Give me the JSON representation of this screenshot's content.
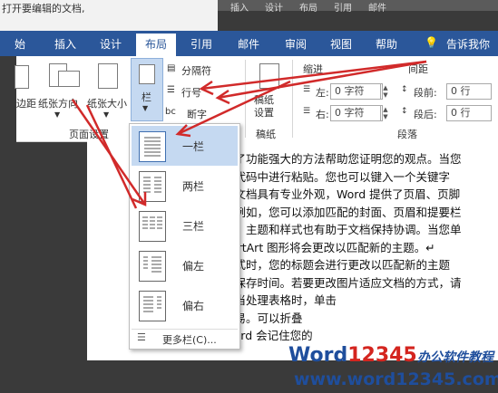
{
  "behind_window": {
    "text": "打开要编辑的文档,"
  },
  "behind_tabs": [
    "插入",
    "设计",
    "布局",
    "引用",
    "邮件"
  ],
  "tabs": [
    {
      "label": "始",
      "active": false
    },
    {
      "label": "插入",
      "active": false
    },
    {
      "label": "设计",
      "active": false
    },
    {
      "label": "布局",
      "active": true
    },
    {
      "label": "引用",
      "active": false
    },
    {
      "label": "邮件",
      "active": false
    },
    {
      "label": "审阅",
      "active": false
    },
    {
      "label": "视图",
      "active": false
    },
    {
      "label": "帮助",
      "active": false
    }
  ],
  "tell_me": "告诉我你",
  "ribbon": {
    "margins": "边距",
    "orientation": "纸张方向",
    "size": "纸张大小",
    "columns": "栏",
    "breaks": "分隔符",
    "line_numbers": "行号",
    "hyphenation": "断字",
    "page_setup_group": "页面设置",
    "draft_paper": "稿纸\n设置",
    "draft_group": "稿纸",
    "indent_header": "缩进",
    "spacing_header": "间距",
    "indent_left_label": "左:",
    "indent_left_value": "0 字符",
    "indent_right_label": "右:",
    "indent_right_value": "0 字符",
    "space_before_label": "段前:",
    "space_before_value": "0 行",
    "space_after_label": "段后:",
    "space_after_value": "0 行",
    "paragraph_group": "段落"
  },
  "dropdown": {
    "items": [
      {
        "label": "一栏",
        "columns": 1,
        "selected": true
      },
      {
        "label": "两栏",
        "columns": 2,
        "selected": false
      },
      {
        "label": "三栏",
        "columns": 3,
        "selected": false
      },
      {
        "label": "偏左",
        "columns": 2,
        "selected": false
      },
      {
        "label": "偏右",
        "columns": 2,
        "selected": false
      }
    ],
    "more": "更多栏(C)..."
  },
  "document_lines": [
    "供了功能强大的方法帮助您证明您的观点。当您",
    "入代码中进行粘贴。您也可以键入一个关键字",
    "的文档具有专业外观，Word 提供了页眉、页脚",
    "。例如，您可以添加匹配的封面、页眉和提要栏",
    "素。主题和样式也有助于文档保持协调。当您单",
    "nartArt 图形将会更改以匹配新的主题。↵",
    "样式时，您的标题会进行更改以匹配新的主题",
    "中保存时间。若要更改图片适应文档的方式，请",
    "。当处理表格时，单击",
    "容易。可以折叠",
    "Word 会记住您的"
  ],
  "watermark": {
    "brand_a": "Word",
    "brand_b": "12345",
    "tagline": "办公软件教程",
    "url": "www.word12345.com"
  },
  "colors": {
    "word_blue": "#2b579a",
    "arrow_red": "#d12a2a",
    "selected_item": "#c5d9f1"
  }
}
